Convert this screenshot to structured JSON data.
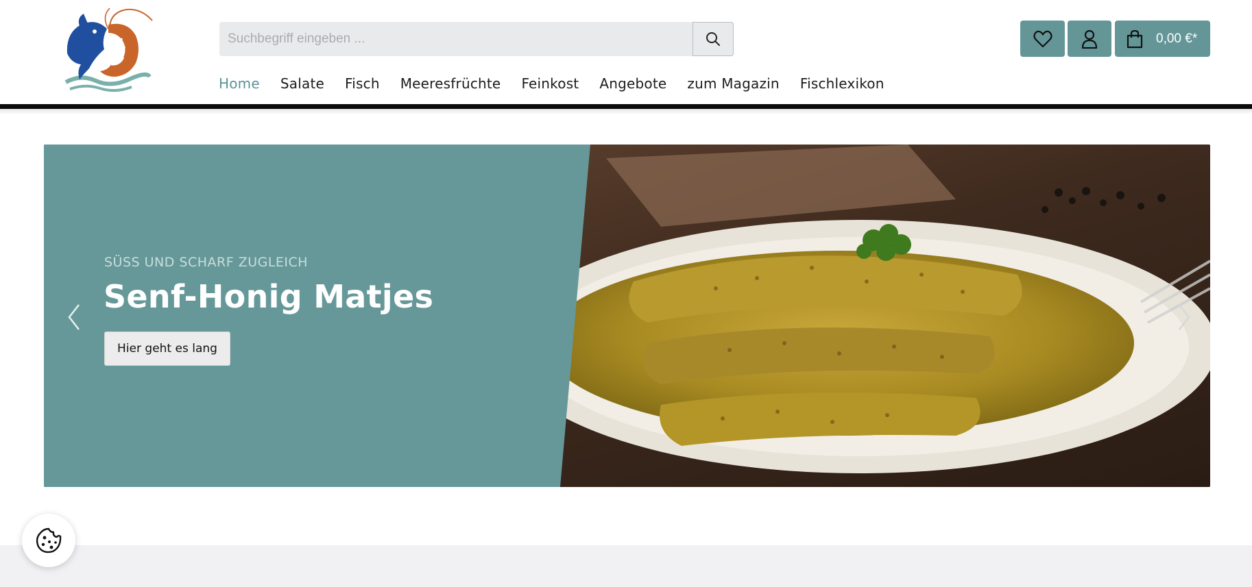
{
  "header": {
    "logo_name": "fish-and-shrimp-logo",
    "search": {
      "placeholder": "Suchbegriff eingeben ...",
      "value": ""
    },
    "cart_total": "0,00 €*"
  },
  "nav": {
    "items": [
      {
        "label": "Home",
        "active": true
      },
      {
        "label": "Salate"
      },
      {
        "label": "Fisch"
      },
      {
        "label": "Meeresfrüchte"
      },
      {
        "label": "Feinkost"
      },
      {
        "label": "Angebote"
      },
      {
        "label": "zum Magazin"
      },
      {
        "label": "Fischlexikon"
      }
    ]
  },
  "hero": {
    "eyebrow": "SÜSS UND SCHARF ZUGLEICH",
    "title": "Senf-Honig Matjes",
    "cta": "Hier geht es lang"
  },
  "colors": {
    "accent": "#649698",
    "panel": "#669899",
    "nav_active": "#5b9399",
    "header_bar": "#0b0b0b",
    "bottom_band": "#f1f1f4"
  },
  "icons": [
    "search-icon",
    "heart-icon",
    "user-icon",
    "shopping-bag-icon",
    "chevron-left-icon",
    "chevron-right-icon",
    "cookie-icon"
  ]
}
